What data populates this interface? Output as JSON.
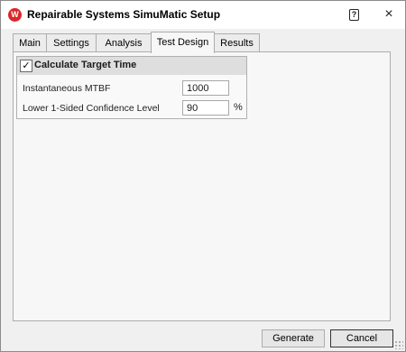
{
  "window": {
    "title": "Repairable Systems SimuMatic Setup",
    "app_icon_letter": "W",
    "help_glyph": "?",
    "close_glyph": "×"
  },
  "tabs": [
    {
      "label": "Main",
      "active": false
    },
    {
      "label": "Settings",
      "active": false
    },
    {
      "label": "Analysis",
      "active": false
    },
    {
      "label": "Test Design",
      "active": true
    },
    {
      "label": "Results",
      "active": false
    }
  ],
  "group": {
    "checked": true,
    "check_glyph": "✓",
    "title": "Calculate Target Time",
    "fields": [
      {
        "label": "Instantaneous MTBF",
        "value": "1000",
        "unit": ""
      },
      {
        "label": "Lower 1-Sided Confidence Level",
        "value": "90",
        "unit": "%"
      }
    ]
  },
  "buttons": {
    "generate": "Generate",
    "cancel": "Cancel"
  },
  "colors": {
    "app_icon": "#d8282b",
    "dialog_bg": "#f0f0f0",
    "group_header": "#dedede"
  }
}
